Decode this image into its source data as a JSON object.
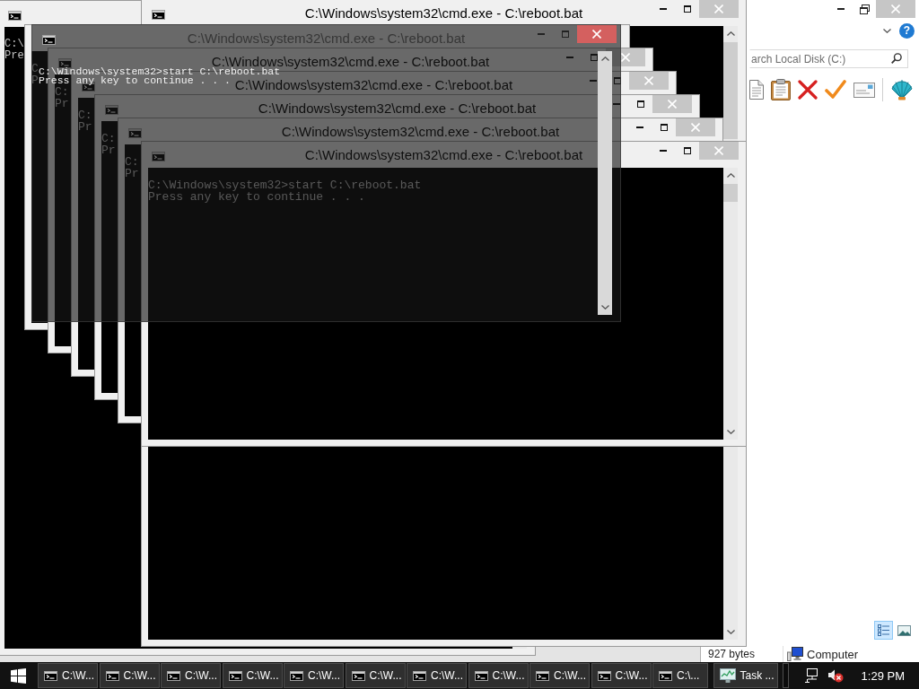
{
  "explorer": {
    "help": "?",
    "search": {
      "placeholder": "arch Local Disk (C:)"
    },
    "view_buttons": [
      {
        "kind": "details",
        "selected": true
      },
      {
        "kind": "tiles",
        "selected": false
      }
    ],
    "status_bar": {
      "size": "927 bytes",
      "location": "Computer"
    }
  },
  "console_windows": [
    {
      "kind": "window",
      "console_lines": [
        "C:\\",
        "Pre"
      ]
    },
    {
      "kind": "window",
      "title": "C:\\Windows\\system32\\cmd.exe - C:\\reboot.bat",
      "close_hovered": false
    },
    {
      "kind": "window",
      "console_lines": [
        "C",
        "P"
      ]
    },
    {
      "kind": "window",
      "title": "C:\\Windows\\system32\\cmd.exe - C:\\reboot.bat",
      "close_hovered": false,
      "console_lines": [
        "C:",
        "Pr"
      ]
    },
    {
      "kind": "window",
      "title": "C:\\Windows\\system32\\cmd.exe - C:\\reboot.bat",
      "close_hovered": false,
      "console_lines": [
        "C:",
        "Pr"
      ]
    },
    {
      "kind": "window",
      "title": "C:\\Windows\\system32\\cmd.exe - C:\\reboot.bat",
      "close_hovered": false,
      "console_lines": [
        "C:",
        "Pr"
      ]
    },
    {
      "kind": "window",
      "title": "C:\\Windows\\system32\\cmd.exe - C:\\reboot.bat",
      "close_hovered": false,
      "console_lines": [
        "C:",
        "Pr"
      ]
    },
    {
      "kind": "window",
      "title": "C:\\Windows\\system32\\cmd.exe - C:\\reboot.bat",
      "close_hovered": false,
      "console_lines": [
        "C:\\Windows\\system32>start C:\\reboot.bat",
        "Press any key to continue . . ."
      ]
    },
    {
      "kind": "ghost",
      "title": "C:\\Windows\\system32\\cmd.exe - C:\\reboot.bat",
      "close_hovered": true,
      "console_lines": [
        "C:\\Windows\\system32>start C:\\reboot.bat",
        "Press any key to continue . . ."
      ]
    }
  ],
  "taskbar": {
    "buttons": [
      {
        "kind": "console",
        "label": "C:\\W..."
      },
      {
        "kind": "console",
        "label": "C:\\W..."
      },
      {
        "kind": "console",
        "label": "C:\\W..."
      },
      {
        "kind": "console",
        "label": "C:\\W..."
      },
      {
        "kind": "console",
        "label": "C:\\W..."
      },
      {
        "kind": "console",
        "label": "C:\\W..."
      },
      {
        "kind": "console",
        "label": "C:\\W..."
      },
      {
        "kind": "console",
        "label": "C:\\W..."
      },
      {
        "kind": "console",
        "label": "C:\\W..."
      },
      {
        "kind": "console",
        "label": "C:\\W..."
      },
      {
        "kind": "console",
        "label": "C:\\..."
      },
      {
        "kind": "task_manager",
        "label": "Task ..."
      },
      {
        "kind": "blank"
      }
    ],
    "clock": "1:29 PM"
  }
}
